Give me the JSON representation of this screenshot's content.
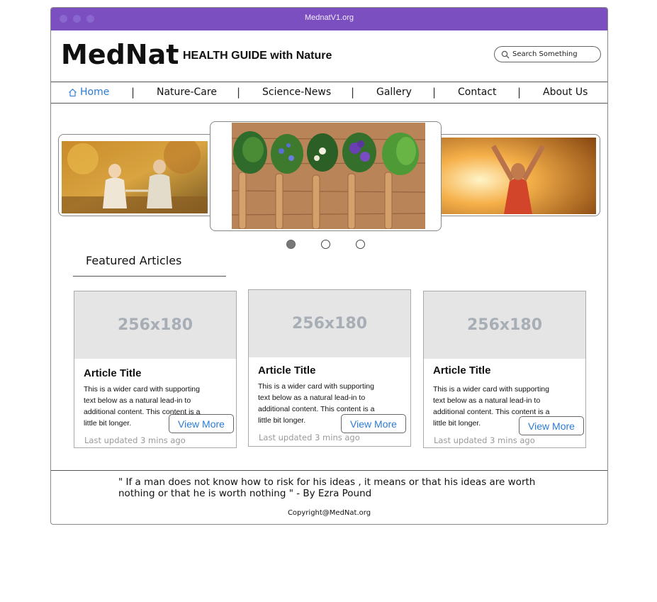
{
  "titlebar": {
    "title": "MednatV1.org"
  },
  "header": {
    "logo": "MedNat",
    "tagline": "HEALTH GUIDE with Nature",
    "search_placeholder": "Search Something"
  },
  "nav": {
    "items": [
      {
        "label": "Home",
        "icon": "home-icon",
        "active": true
      },
      {
        "label": "Nature-Care"
      },
      {
        "label": "Science-News"
      },
      {
        "label": "Gallery"
      },
      {
        "label": "Contact"
      },
      {
        "label": "About Us"
      }
    ],
    "separator": "|"
  },
  "carousel": {
    "slides": [
      "couple-walking-autumn",
      "herbs-on-wooden-spoons",
      "man-arms-raised-sunset"
    ],
    "active_index": 1
  },
  "featured": {
    "title": "Featured Articles",
    "cards": [
      {
        "thumb": "256x180",
        "title": "Article Title",
        "text": "This is a wider card with supporting text below as a natural lead-in to additional content. This content is a little bit longer.",
        "button": "View More",
        "updated": "Last updated 3 mins ago"
      },
      {
        "thumb": "256x180",
        "title": "Article Title",
        "text": "This is a wider card with supporting text below as a natural lead-in to additional content. This content is a little bit longer.",
        "button": "View More",
        "updated": "Last updated 3 mins ago"
      },
      {
        "thumb": "256x180",
        "title": "Article Title",
        "text": "This is a wider card with supporting text below as a natural lead-in to additional content. This content is a little bit longer.",
        "button": "View More",
        "updated": "Last updated 3 mins ago"
      }
    ]
  },
  "footer": {
    "quote": "\" If a man does not know how to risk for his ideas , it means or that his ideas are worth nothing or that he is worth nothing \" - By Ezra Pound",
    "copyright": "Copyright@MedNat.org"
  },
  "colors": {
    "titlebar": "#7b4fbf",
    "link": "#2b7bd6"
  }
}
